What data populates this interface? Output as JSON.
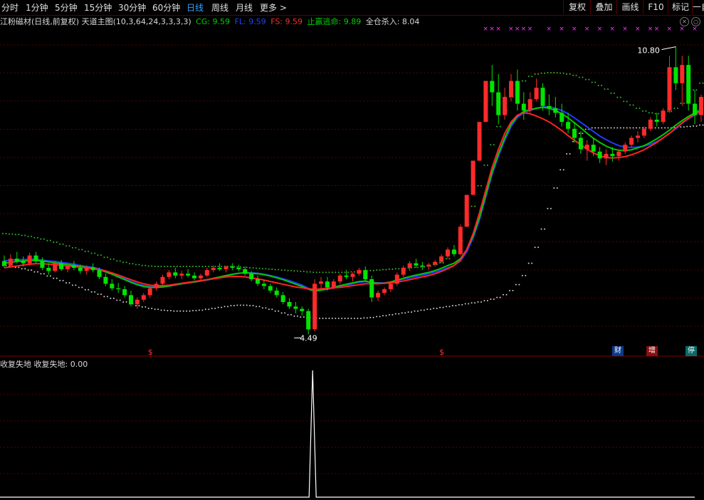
{
  "toolbar": {
    "tabs": [
      "分时",
      "1分钟",
      "5分钟",
      "15分钟",
      "30分钟",
      "60分钟",
      "日线",
      "周线",
      "月线",
      "更多 >"
    ],
    "active": "日线",
    "buttons": [
      "复权",
      "叠加",
      "画线",
      "F10",
      "标记",
      "一自"
    ]
  },
  "infobar": {
    "title": "江粉磁材(日线,前复权) 天道主图(10,3,64,24,3,3,3,3)",
    "cg": "CG: 9.59",
    "fl": "FL: 9.59",
    "fs": "FS: 9.59",
    "zy": "止赢逃命: 9.89",
    "qc": "全仓杀入: 8.04"
  },
  "annotations": {
    "high": "10.80",
    "low": "4.49",
    "cai": "财",
    "zeng": "增",
    "ting": "停",
    "s_mark": "$"
  },
  "subinfo": "收复失地 收复失地: 0.00",
  "colors": {
    "up": "#ff2a2a",
    "down": "#00e400",
    "cg": "#1f3cff",
    "fl": "#00c800",
    "fs": "#ff2222",
    "band": "#2eb82e",
    "lowerband": "#cccccc",
    "xmark": "#ff33ff"
  },
  "chart_data": {
    "type": "candlestick",
    "ylim": [
      4.2,
      11.2
    ],
    "candles_olhc": [
      [
        6.1,
        6.22,
        5.95,
        6.0
      ],
      [
        6.0,
        6.25,
        5.95,
        6.15
      ],
      [
        6.15,
        6.3,
        6.05,
        6.1
      ],
      [
        6.1,
        6.2,
        5.98,
        6.05
      ],
      [
        6.05,
        6.28,
        6.0,
        6.22
      ],
      [
        6.22,
        6.3,
        6.05,
        6.1
      ],
      [
        6.1,
        6.18,
        5.9,
        5.95
      ],
      [
        5.95,
        6.05,
        5.8,
        5.88
      ],
      [
        5.88,
        6.1,
        5.85,
        6.05
      ],
      [
        6.05,
        6.12,
        5.88,
        5.92
      ],
      [
        5.92,
        6.05,
        5.85,
        6.0
      ],
      [
        6.0,
        6.1,
        5.9,
        5.95
      ],
      [
        5.95,
        6.02,
        5.82,
        5.88
      ],
      [
        5.88,
        6.0,
        5.8,
        5.96
      ],
      [
        5.96,
        6.05,
        5.85,
        5.9
      ],
      [
        5.9,
        5.95,
        5.7,
        5.75
      ],
      [
        5.75,
        5.82,
        5.55,
        5.6
      ],
      [
        5.6,
        5.7,
        5.45,
        5.5
      ],
      [
        5.5,
        5.62,
        5.4,
        5.48
      ],
      [
        5.48,
        5.55,
        5.3,
        5.35
      ],
      [
        5.35,
        5.45,
        5.1,
        5.15
      ],
      [
        5.15,
        5.3,
        5.05,
        5.25
      ],
      [
        5.25,
        5.4,
        5.2,
        5.35
      ],
      [
        5.35,
        5.55,
        5.3,
        5.5
      ],
      [
        5.5,
        5.65,
        5.45,
        5.6
      ],
      [
        5.6,
        5.8,
        5.55,
        5.75
      ],
      [
        5.75,
        5.9,
        5.7,
        5.85
      ],
      [
        5.85,
        5.95,
        5.72,
        5.78
      ],
      [
        5.78,
        5.88,
        5.7,
        5.82
      ],
      [
        5.82,
        5.92,
        5.74,
        5.78
      ],
      [
        5.78,
        5.85,
        5.68,
        5.72
      ],
      [
        5.72,
        5.82,
        5.65,
        5.78
      ],
      [
        5.78,
        5.95,
        5.75,
        5.9
      ],
      [
        5.9,
        6.0,
        5.85,
        5.95
      ],
      [
        5.95,
        6.05,
        5.88,
        5.92
      ],
      [
        5.92,
        6.0,
        5.85,
        5.98
      ],
      [
        5.98,
        6.05,
        5.9,
        5.95
      ],
      [
        5.95,
        6.02,
        5.88,
        5.92
      ],
      [
        5.92,
        5.98,
        5.78,
        5.82
      ],
      [
        5.82,
        5.88,
        5.65,
        5.7
      ],
      [
        5.7,
        5.78,
        5.55,
        5.6
      ],
      [
        5.6,
        5.68,
        5.48,
        5.55
      ],
      [
        5.55,
        5.6,
        5.4,
        5.45
      ],
      [
        5.45,
        5.52,
        5.3,
        5.35
      ],
      [
        5.35,
        5.42,
        5.15,
        5.2
      ],
      [
        5.2,
        5.28,
        5.05,
        5.1
      ],
      [
        5.1,
        5.2,
        4.95,
        5.05
      ],
      [
        5.05,
        5.1,
        4.9,
        5.0
      ],
      [
        5.0,
        5.05,
        4.49,
        4.6
      ],
      [
        4.6,
        5.7,
        4.55,
        5.6
      ],
      [
        5.6,
        5.75,
        5.5,
        5.65
      ],
      [
        5.65,
        5.75,
        5.45,
        5.52
      ],
      [
        5.52,
        5.7,
        5.48,
        5.65
      ],
      [
        5.65,
        5.82,
        5.6,
        5.78
      ],
      [
        5.78,
        5.9,
        5.7,
        5.75
      ],
      [
        5.75,
        5.85,
        5.65,
        5.82
      ],
      [
        5.82,
        5.95,
        5.78,
        5.9
      ],
      [
        5.9,
        5.98,
        5.65,
        5.7
      ],
      [
        5.7,
        5.78,
        5.2,
        5.3
      ],
      [
        5.3,
        5.45,
        5.22,
        5.4
      ],
      [
        5.4,
        5.52,
        5.35,
        5.48
      ],
      [
        5.48,
        5.65,
        5.42,
        5.6
      ],
      [
        5.6,
        5.85,
        5.55,
        5.8
      ],
      [
        5.8,
        6.0,
        5.75,
        5.95
      ],
      [
        5.95,
        6.1,
        5.88,
        6.05
      ],
      [
        6.05,
        6.15,
        5.95,
        6.0
      ],
      [
        6.0,
        6.08,
        5.9,
        5.98
      ],
      [
        5.98,
        6.06,
        5.9,
        6.02
      ],
      [
        6.02,
        6.12,
        5.98,
        6.08
      ],
      [
        6.08,
        6.25,
        6.05,
        6.2
      ],
      [
        6.2,
        6.4,
        6.15,
        6.35
      ],
      [
        6.35,
        6.45,
        6.2,
        6.25
      ],
      [
        6.25,
        6.9,
        6.22,
        6.85
      ],
      [
        6.85,
        7.55,
        6.85,
        7.55
      ],
      [
        7.55,
        8.3,
        7.55,
        8.3
      ],
      [
        8.3,
        9.15,
        8.3,
        9.15
      ],
      [
        9.15,
        10.05,
        9.15,
        10.05
      ],
      [
        10.05,
        10.4,
        9.5,
        9.8
      ],
      [
        9.8,
        10.2,
        9.1,
        9.3
      ],
      [
        9.3,
        9.9,
        9.2,
        9.7
      ],
      [
        9.7,
        10.2,
        9.6,
        10.05
      ],
      [
        10.05,
        10.3,
        9.4,
        9.55
      ],
      [
        9.55,
        9.8,
        9.2,
        9.4
      ],
      [
        9.4,
        9.8,
        9.35,
        9.65
      ],
      [
        9.65,
        10.1,
        9.6,
        9.9
      ],
      [
        9.9,
        10.0,
        9.4,
        9.5
      ],
      [
        9.5,
        9.75,
        9.3,
        9.45
      ],
      [
        9.45,
        9.7,
        9.25,
        9.35
      ],
      [
        9.35,
        9.55,
        9.05,
        9.15
      ],
      [
        9.15,
        9.35,
        8.9,
        9.0
      ],
      [
        9.0,
        9.15,
        8.7,
        8.8
      ],
      [
        8.8,
        8.95,
        8.45,
        8.55
      ],
      [
        8.55,
        8.75,
        8.3,
        8.65
      ],
      [
        8.65,
        8.8,
        8.4,
        8.5
      ],
      [
        8.5,
        8.6,
        8.25,
        8.35
      ],
      [
        8.35,
        8.55,
        8.2,
        8.45
      ],
      [
        8.45,
        8.6,
        8.28,
        8.4
      ],
      [
        8.4,
        8.55,
        8.3,
        8.5
      ],
      [
        8.5,
        8.7,
        8.45,
        8.65
      ],
      [
        8.65,
        8.85,
        8.6,
        8.8
      ],
      [
        8.8,
        8.95,
        8.7,
        8.85
      ],
      [
        8.85,
        9.05,
        8.8,
        9.0
      ],
      [
        9.0,
        9.25,
        8.95,
        9.2
      ],
      [
        9.2,
        9.35,
        9.05,
        9.15
      ],
      [
        9.15,
        9.45,
        9.1,
        9.4
      ],
      [
        9.4,
        10.6,
        9.35,
        10.35
      ],
      [
        10.35,
        10.8,
        9.85,
        10.0
      ],
      [
        10.0,
        10.6,
        9.5,
        10.4
      ],
      [
        10.4,
        10.6,
        9.4,
        9.55
      ],
      [
        9.55,
        9.85,
        9.1,
        9.3
      ],
      [
        9.3,
        9.75,
        9.15,
        9.7
      ]
    ],
    "cg_line": [
      6.1,
      6.12,
      6.13,
      6.13,
      6.14,
      6.14,
      6.12,
      6.1,
      6.09,
      6.07,
      6.05,
      6.03,
      6.0,
      5.98,
      5.96,
      5.93,
      5.88,
      5.83,
      5.77,
      5.71,
      5.65,
      5.6,
      5.56,
      5.54,
      5.53,
      5.53,
      5.55,
      5.57,
      5.6,
      5.62,
      5.64,
      5.66,
      5.68,
      5.71,
      5.74,
      5.77,
      5.8,
      5.83,
      5.84,
      5.84,
      5.83,
      5.81,
      5.78,
      5.75,
      5.71,
      5.67,
      5.62,
      5.57,
      5.5,
      5.45,
      5.46,
      5.48,
      5.51,
      5.54,
      5.57,
      5.6,
      5.63,
      5.65,
      5.63,
      5.62,
      5.62,
      5.64,
      5.67,
      5.7,
      5.73,
      5.76,
      5.79,
      5.82,
      5.86,
      5.9,
      5.95,
      6.0,
      6.1,
      6.3,
      6.6,
      7.0,
      7.5,
      8.0,
      8.4,
      8.75,
      9.05,
      9.25,
      9.35,
      9.4,
      9.45,
      9.48,
      9.48,
      9.45,
      9.4,
      9.33,
      9.24,
      9.14,
      9.04,
      8.94,
      8.84,
      8.76,
      8.69,
      8.63,
      8.6,
      8.59,
      8.6,
      8.62,
      8.66,
      8.72,
      8.8,
      8.9,
      9.0,
      9.12,
      9.22,
      9.3,
      9.38
    ],
    "fl_line": [
      6.05,
      6.07,
      6.09,
      6.1,
      6.11,
      6.11,
      6.1,
      6.08,
      6.06,
      6.04,
      6.02,
      6.0,
      5.98,
      5.96,
      5.94,
      5.91,
      5.86,
      5.81,
      5.75,
      5.69,
      5.63,
      5.58,
      5.54,
      5.52,
      5.52,
      5.53,
      5.55,
      5.58,
      5.6,
      5.62,
      5.64,
      5.66,
      5.69,
      5.72,
      5.75,
      5.78,
      5.81,
      5.83,
      5.84,
      5.83,
      5.82,
      5.8,
      5.77,
      5.73,
      5.69,
      5.64,
      5.59,
      5.54,
      5.48,
      5.44,
      5.46,
      5.49,
      5.52,
      5.56,
      5.59,
      5.62,
      5.65,
      5.66,
      5.63,
      5.61,
      5.61,
      5.64,
      5.68,
      5.72,
      5.76,
      5.79,
      5.82,
      5.85,
      5.89,
      5.94,
      6.0,
      6.05,
      6.15,
      6.35,
      6.65,
      7.05,
      7.55,
      8.05,
      8.45,
      8.8,
      9.1,
      9.28,
      9.38,
      9.42,
      9.45,
      9.47,
      9.45,
      9.4,
      9.33,
      9.24,
      9.13,
      9.02,
      8.9,
      8.79,
      8.7,
      8.62,
      8.56,
      8.53,
      8.52,
      8.54,
      8.58,
      8.63,
      8.7,
      8.78,
      8.87,
      8.97,
      9.08,
      9.18,
      9.27,
      9.35,
      9.42
    ],
    "fs_line": [
      5.95,
      5.97,
      5.99,
      6.01,
      6.03,
      6.04,
      6.04,
      6.03,
      6.02,
      6.0,
      5.99,
      5.98,
      5.96,
      5.95,
      5.93,
      5.91,
      5.88,
      5.84,
      5.79,
      5.74,
      5.69,
      5.64,
      5.6,
      5.57,
      5.56,
      5.56,
      5.57,
      5.59,
      5.61,
      5.63,
      5.65,
      5.67,
      5.69,
      5.71,
      5.73,
      5.75,
      5.76,
      5.76,
      5.75,
      5.73,
      5.71,
      5.68,
      5.65,
      5.62,
      5.59,
      5.56,
      5.53,
      5.51,
      5.49,
      5.48,
      5.49,
      5.5,
      5.51,
      5.52,
      5.54,
      5.56,
      5.58,
      5.6,
      5.6,
      5.6,
      5.61,
      5.62,
      5.64,
      5.66,
      5.69,
      5.72,
      5.75,
      5.78,
      5.82,
      5.87,
      5.93,
      6.0,
      6.12,
      6.35,
      6.7,
      7.15,
      7.65,
      8.15,
      8.55,
      8.9,
      9.15,
      9.3,
      9.35,
      9.33,
      9.28,
      9.22,
      9.15,
      9.06,
      8.96,
      8.85,
      8.75,
      8.65,
      8.55,
      8.47,
      8.41,
      8.37,
      8.36,
      8.37,
      8.39,
      8.43,
      8.48,
      8.54,
      8.62,
      8.7,
      8.8,
      8.9,
      9.02,
      9.13,
      9.23,
      9.32,
      9.4
    ],
    "band_upper": [
      6.7,
      6.69,
      6.68,
      6.66,
      6.64,
      6.61,
      6.58,
      6.55,
      6.51,
      6.47,
      6.43,
      6.39,
      6.35,
      6.31,
      6.27,
      6.23,
      6.18,
      6.14,
      6.1,
      6.07,
      6.04,
      6.02,
      6.0,
      5.99,
      5.98,
      5.98,
      5.98,
      5.98,
      5.98,
      5.98,
      5.98,
      5.98,
      5.98,
      5.98,
      5.98,
      5.98,
      5.98,
      5.97,
      5.96,
      5.95,
      5.94,
      5.93,
      5.92,
      5.91,
      5.9,
      5.89,
      5.88,
      5.87,
      5.86,
      5.85,
      5.85,
      5.85,
      5.85,
      5.85,
      5.85,
      5.86,
      5.87,
      5.88,
      5.89,
      5.9,
      5.91,
      5.92,
      5.93,
      5.94,
      5.95,
      5.96,
      5.97,
      5.99,
      6.02,
      6.06,
      6.15,
      6.3,
      6.55,
      6.9,
      7.3,
      7.75,
      8.2,
      8.65,
      9.05,
      9.4,
      9.7,
      9.9,
      10.05,
      10.15,
      10.2,
      10.22,
      10.23,
      10.23,
      10.22,
      10.2,
      10.17,
      10.13,
      10.08,
      10.02,
      9.95,
      9.87,
      9.78,
      9.69,
      9.6,
      9.52,
      9.45,
      9.39,
      9.35,
      9.33,
      9.34,
      9.38,
      9.45,
      9.56,
      9.7,
      9.85,
      10.0
    ],
    "band_lower": [
      6.0,
      5.98,
      5.96,
      5.93,
      5.9,
      5.86,
      5.82,
      5.77,
      5.72,
      5.67,
      5.62,
      5.57,
      5.52,
      5.47,
      5.42,
      5.37,
      5.32,
      5.28,
      5.24,
      5.2,
      5.16,
      5.12,
      5.09,
      5.06,
      5.04,
      5.02,
      5.01,
      5.0,
      5.0,
      5.0,
      5.01,
      5.02,
      5.04,
      5.06,
      5.08,
      5.1,
      5.12,
      5.13,
      5.13,
      5.12,
      5.1,
      5.07,
      5.04,
      5.0,
      4.96,
      4.92,
      4.89,
      4.87,
      4.85,
      4.84,
      4.84,
      4.84,
      4.84,
      4.84,
      4.84,
      4.84,
      4.84,
      4.85,
      4.86,
      4.88,
      4.9,
      4.92,
      4.94,
      4.96,
      4.98,
      5.0,
      5.02,
      5.04,
      5.06,
      5.08,
      5.1,
      5.12,
      5.14,
      5.16,
      5.18,
      5.2,
      5.23,
      5.26,
      5.3,
      5.36,
      5.45,
      5.58,
      5.78,
      6.05,
      6.4,
      6.8,
      7.25,
      7.7,
      8.1,
      8.45,
      8.72,
      8.9,
      8.99,
      9.02,
      9.02,
      9.02,
      9.02,
      9.02,
      9.02,
      9.02,
      9.02,
      9.02,
      9.02,
      9.02,
      9.02,
      9.02,
      9.03,
      9.04,
      9.05,
      9.06,
      9.08
    ],
    "xmark_indices": [
      76,
      77,
      78,
      80,
      81,
      82,
      83,
      86,
      88,
      90,
      92,
      94,
      96,
      98,
      100,
      102,
      103,
      105,
      107,
      109
    ],
    "sub_indicator": {
      "title": "收复失地",
      "value": 0.0,
      "spike_index": 48,
      "spike_value": 1.0
    }
  }
}
